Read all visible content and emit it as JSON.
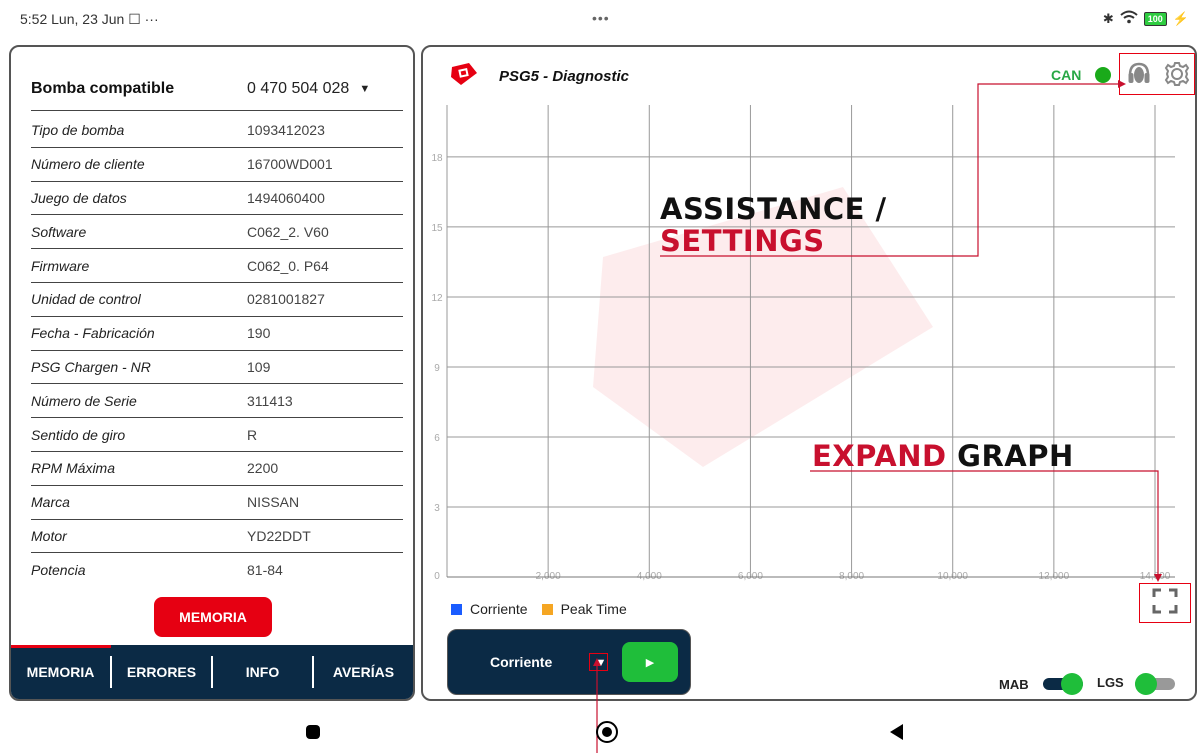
{
  "status_bar": {
    "time": "5:52",
    "date": "Lun, 23 Jun",
    "center_dots": "•••",
    "battery": "100"
  },
  "left_panel": {
    "pump_label": "Bomba compatible",
    "pump_value": "0 470 504 028",
    "rows": [
      {
        "key": "Tipo de bomba",
        "value": "1093412023"
      },
      {
        "key": "Número de cliente",
        "value": "16700WD001"
      },
      {
        "key": "Juego de datos",
        "value": "1494060400"
      },
      {
        "key": "Software",
        "value": "C062_2. V60"
      },
      {
        "key": "Firmware",
        "value": "C062_0. P64"
      },
      {
        "key": "Unidad de control",
        "value": "0281001827"
      },
      {
        "key": "Fecha - Fabricación",
        "value": "190"
      },
      {
        "key": "PSG Chargen - NR",
        "value": "109"
      },
      {
        "key": "Número de Serie",
        "value": "311413"
      },
      {
        "key": "Sentido de giro",
        "value": "R"
      },
      {
        "key": "RPM Máxima",
        "value": "2200"
      },
      {
        "key": "Marca",
        "value": "NISSAN"
      },
      {
        "key": "Motor",
        "value": "YD22DDT"
      },
      {
        "key": "Potencia",
        "value": "81-84"
      }
    ],
    "memoria_button": "MEMORIA",
    "tabs": [
      "MEMORIA",
      "ERRORES",
      "INFO",
      "AVERÍAS"
    ]
  },
  "right_panel": {
    "title": "PSG5 - Diagnostic",
    "can_label": "CAN",
    "legend": [
      {
        "label": "Corriente",
        "color": "#1a5cff"
      },
      {
        "label": "Peak Time",
        "color": "#f5a623"
      }
    ],
    "selector_label": "Corriente",
    "toggles": [
      {
        "label": "MAB",
        "on": true
      },
      {
        "label": "LGS",
        "on": false
      }
    ]
  },
  "chart_data": {
    "type": "line",
    "series": [],
    "x_ticks": [
      "0",
      "2,000",
      "4,000",
      "6,000",
      "8,000",
      "10,000",
      "12,000",
      "14,000"
    ],
    "y_ticks": [
      "3",
      "6",
      "9",
      "12",
      "15",
      "18"
    ],
    "xlim": [
      0,
      14000
    ],
    "ylim": [
      0,
      18
    ],
    "grid": true
  },
  "annotations": {
    "assistance": "ASSISTANCE /",
    "settings": "SETTINGS",
    "expand": "EXPAND",
    "graph": "GRAPH"
  },
  "colors": {
    "accent_red": "#e60012",
    "navy": "#0b2a45",
    "green": "#1fbe3a"
  }
}
